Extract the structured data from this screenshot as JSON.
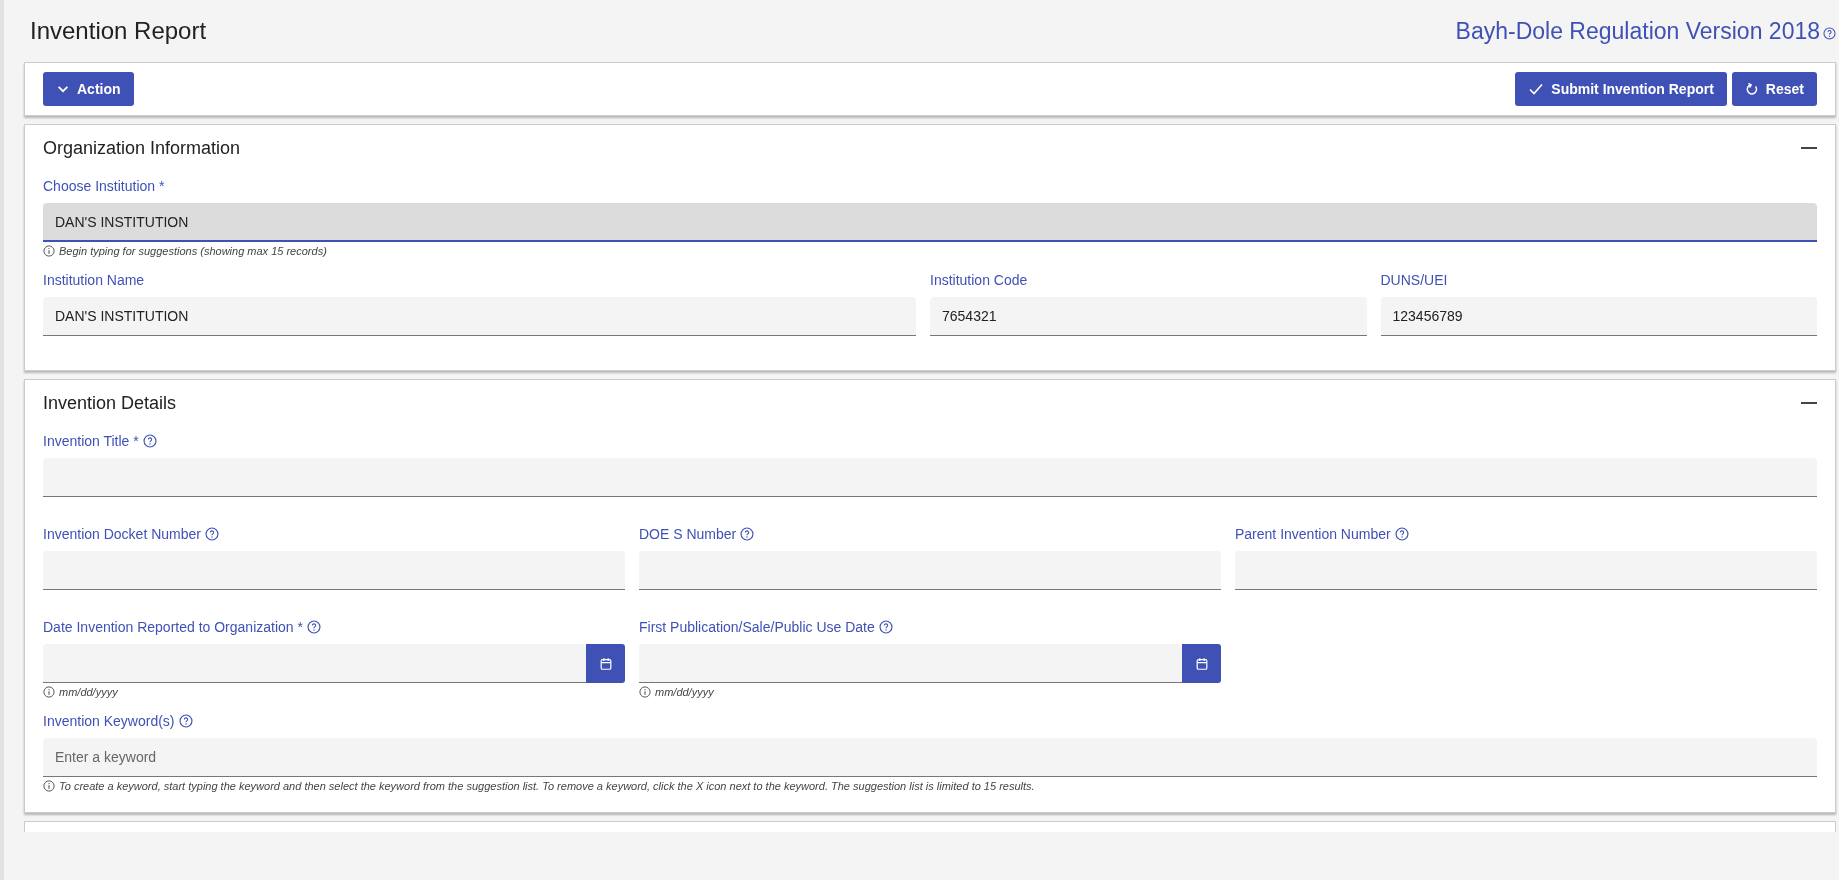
{
  "page": {
    "title": "Invention Report",
    "regulation": "Bayh-Dole Regulation Version 2018"
  },
  "toolbar": {
    "left_buttons": [
      {
        "label": "Action"
      }
    ],
    "right_buttons": [
      {
        "label": "Submit Invention Report"
      },
      {
        "label": "Reset"
      }
    ]
  },
  "sections": [
    {
      "title": "Organization Information",
      "expanded": true,
      "rows": [
        [
          {
            "kind": "text",
            "label": "Choose Institution *",
            "help": false,
            "value": "DAN'S INSTITUTION",
            "focused": true,
            "hint": "Begin typing for suggestions (showing max 15 records)"
          }
        ],
        [
          {
            "kind": "text",
            "label": "Institution Name",
            "help": false,
            "value": "DAN'S INSTITUTION",
            "focused": false
          },
          {
            "kind": "text",
            "label": "Institution Code",
            "help": false,
            "value": "7654321",
            "focused": false
          },
          {
            "kind": "text",
            "label": "DUNS/UEI",
            "help": false,
            "value": "123456789",
            "focused": false
          }
        ]
      ]
    },
    {
      "title": "Invention Details",
      "expanded": true,
      "rows": [
        [
          {
            "kind": "text",
            "label": "Invention Title *",
            "help": true,
            "focused": false
          }
        ],
        [
          {
            "kind": "text",
            "label": "Invention Docket Number",
            "help": true,
            "focused": false
          },
          {
            "kind": "text",
            "label": "DOE S Number",
            "help": true,
            "focused": false
          },
          {
            "kind": "text",
            "label": "Parent Invention Number",
            "help": true,
            "focused": false
          }
        ],
        [
          {
            "kind": "date",
            "label": "Date Invention Reported to Organization *",
            "help": true,
            "focused": false,
            "hint": "mm/dd/yyyy"
          },
          {
            "kind": "date",
            "label": "First Publication/Sale/Public Use Date",
            "help": true,
            "focused": false,
            "hint": "mm/dd/yyyy"
          }
        ],
        [
          {
            "kind": "text",
            "label": "Invention Keyword(s)",
            "help": true,
            "placeholder": "Enter a keyword",
            "focused": false,
            "hint": "To create a keyword, start typing the keyword and then select the keyword from the suggestion list. To remove a keyword, click the X icon next to the keyword. The suggestion list is limited to 15 results."
          }
        ]
      ]
    }
  ]
}
